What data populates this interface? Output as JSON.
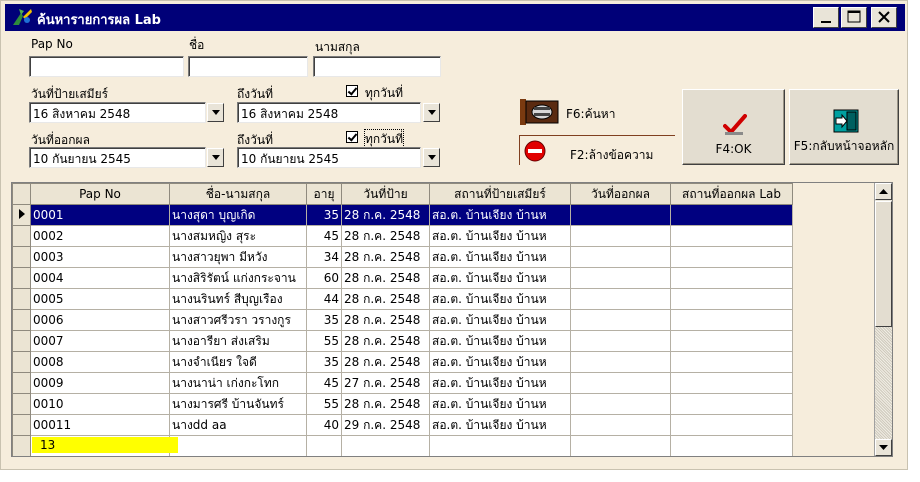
{
  "window": {
    "title": "ค้นหารายการผล Lab"
  },
  "form": {
    "pap_no_label": "Pap No",
    "name_label": "ชื่อ",
    "surname_label": "นามสกุล",
    "pap_no_value": "",
    "name_value": "",
    "surname_value": "",
    "smear_date_label": "วันที่ป้ายเสมียร์",
    "smear_to_label": "ถึงวันที่",
    "smear_all_label": "ทุกวันที่",
    "smear_all_checked": true,
    "smear_from_value": "16  สิงหาคม     2548",
    "smear_to_value": "16  สิงหาคม     2548",
    "result_date_label": "วันที่ออกผล",
    "result_to_label": "ถึงวันที่",
    "result_all_label": "ทุกวันที่",
    "result_all_checked": true,
    "result_from_value": "10  กันยายน     2545",
    "result_to_value": "10  กันยายน     2545"
  },
  "actions": {
    "search_label": "F6:ค้นหา",
    "clear_label": "F2:ล้างข้อความ",
    "ok_label": "F4:OK",
    "back_label": "F5:กลับหน้าจอหลัก"
  },
  "grid": {
    "columns": [
      "Pap No",
      "ชื่อ-นามสกุล",
      "อายุ",
      "วันที่ป้าย",
      "สถานที่ป้ายเสมียร์",
      "วันที่ออกผล",
      "สถานที่ออกผล Lab"
    ],
    "rows": [
      [
        "0001",
        "นางสุดา บุญเกิด",
        "35",
        "28 ก.ค. 2548",
        "สอ.ต. บ้านเจียง บ้านห",
        "",
        ""
      ],
      [
        "0002",
        "นางสมหญิง สุระ",
        "45",
        "28 ก.ค. 2548",
        "สอ.ต. บ้านเจียง บ้านห",
        "",
        ""
      ],
      [
        "0003",
        "นางสาวยุพา มีหวัง",
        "34",
        "28 ก.ค. 2548",
        "สอ.ต. บ้านเจียง บ้านห",
        "",
        ""
      ],
      [
        "0004",
        "นางสิริรัตน์ แก่งกระจาน",
        "60",
        "28 ก.ค. 2548",
        "สอ.ต. บ้านเจียง บ้านห",
        "",
        ""
      ],
      [
        "0005",
        "นางนรินทร์ สีบุญเรือง",
        "44",
        "28 ก.ค. 2548",
        "สอ.ต. บ้านเจียง บ้านห",
        "",
        ""
      ],
      [
        "0006",
        "นางสาวศรีวรา วรางกูร",
        "35",
        "28 ก.ค. 2548",
        "สอ.ต. บ้านเจียง บ้านห",
        "",
        ""
      ],
      [
        "0007",
        "นางอารียา ส่งเสริม",
        "55",
        "28 ก.ค. 2548",
        "สอ.ต. บ้านเจียง บ้านห",
        "",
        ""
      ],
      [
        "0008",
        "นางจำเนียร ใจดี",
        "35",
        "28 ก.ค. 2548",
        "สอ.ต. บ้านเจียง บ้านห",
        "",
        ""
      ],
      [
        "0009",
        "นางนาน่า เก่งกะโทก",
        "45",
        "27 ก.ค. 2548",
        "สอ.ต. บ้านเจียง บ้านห",
        "",
        ""
      ],
      [
        "0010",
        "นางมารศรี บ้านจันทร์",
        "55",
        "28 ก.ค. 2548",
        "สอ.ต. บ้านเจียง บ้านห",
        "",
        ""
      ],
      [
        "00011",
        "นางdd aa",
        "40",
        "29 ก.ค. 2548",
        "สอ.ต. บ้านเจียง บ้านห",
        "",
        ""
      ]
    ],
    "selected_row": 0
  },
  "status": {
    "record_count": "13"
  },
  "colors": {
    "titlebar": "#000078",
    "selection": "#000080",
    "window_bg": "#f6eddc",
    "count_bg": "#ffff00"
  },
  "icons": {
    "app": "lab-search-icon",
    "search": "file-cabinet-icon",
    "clear": "no-entry-icon",
    "ok": "checkmark-icon",
    "back": "exit-door-icon"
  }
}
